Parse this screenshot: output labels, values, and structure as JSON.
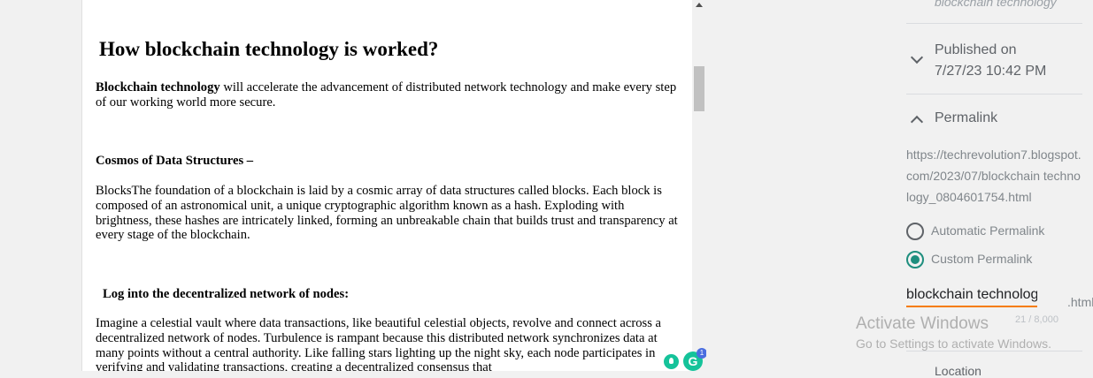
{
  "article": {
    "title": "How blockchain technology is worked?",
    "intro_bold": "Blockchain technology",
    "intro_rest": " will accelerate the advancement of distributed network technology and make every step of our working world more secure.",
    "section1_heading": "Cosmos of Data Structures –",
    "section1_text": " BlocksThe foundation of a blockchain is laid by a cosmic array of data structures called blocks. Each block is composed of an astronomical unit, a unique cryptographic algorithm known as a hash. Exploding with brightness, these hashes are intricately linked, forming an unbreakable chain that builds trust and transparency at every stage of the blockchain.",
    "section2_heading": "Log into the decentralized network of nodes:",
    "section2_text": "Imagine a celestial vault where data transactions, like beautiful celestial objects, revolve and connect across a decentralized network of nodes. Turbulence is rampant because this distributed network synchronizes data at many points without a central authority. Like falling stars lighting up the night sky, each node participates in verifying and validating transactions, creating a decentralized consensus that"
  },
  "settings": {
    "faded_label": "blockchain technology",
    "published_label": "Published on",
    "published_value": "7/27/23 10:42 PM",
    "permalink_label": "Permalink",
    "permalink_url": "https://techrevolution7.blogspot.com/2023/07/blockchain technology_0804601754.html",
    "automatic_label": "Automatic Permalink",
    "custom_label": "Custom Permalink",
    "slug_value": "blockchain technology",
    "slug_ext": ".html",
    "char_count": "21 / 8,000",
    "next_section": "Location"
  },
  "watermark": {
    "line1": "Activate Windows",
    "line2": "Go to Settings to activate Windows."
  },
  "grammarly": {
    "logo": "G",
    "badge": "1"
  }
}
